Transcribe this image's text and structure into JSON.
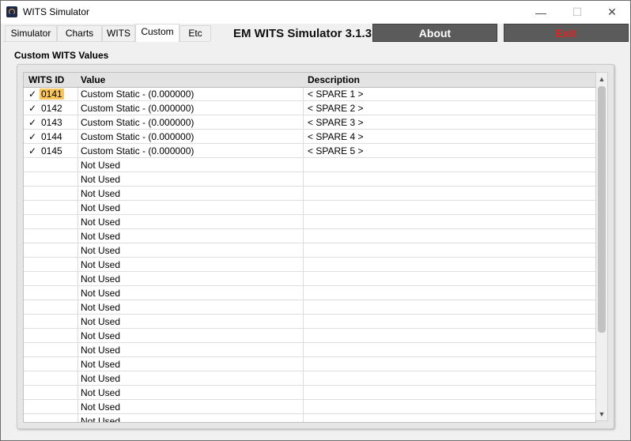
{
  "window": {
    "title": "WITS Simulator",
    "controls": {
      "minimize": "—",
      "maximize": "☐",
      "close": "✕"
    }
  },
  "tabs": [
    {
      "label": "Simulator",
      "active": false
    },
    {
      "label": "Charts",
      "active": false
    },
    {
      "label": "WITS",
      "active": false
    },
    {
      "label": "Custom",
      "active": true
    },
    {
      "label": "Etc",
      "active": false
    }
  ],
  "app_header": "EM WITS Simulator 3.1.3",
  "buttons": {
    "about": "About",
    "exit": "Exit"
  },
  "section_title": "Custom WITS Values",
  "grid": {
    "columns": [
      "WITS ID",
      "Value",
      "Description"
    ],
    "rows": [
      {
        "checked": "✓",
        "id": "0141",
        "value": "Custom Static - (0.000000)",
        "description": "< SPARE 1 >",
        "selected": true
      },
      {
        "checked": "✓",
        "id": "0142",
        "value": "Custom Static - (0.000000)",
        "description": "< SPARE 2 >"
      },
      {
        "checked": "✓",
        "id": "0143",
        "value": "Custom Static - (0.000000)",
        "description": "< SPARE 3 >"
      },
      {
        "checked": "✓",
        "id": "0144",
        "value": "Custom Static - (0.000000)",
        "description": "< SPARE 4 >"
      },
      {
        "checked": "✓",
        "id": "0145",
        "value": "Custom Static - (0.000000)",
        "description": "< SPARE 5 >"
      },
      {
        "checked": "",
        "id": "",
        "value": "Not Used",
        "description": ""
      },
      {
        "checked": "",
        "id": "",
        "value": "Not Used",
        "description": ""
      },
      {
        "checked": "",
        "id": "",
        "value": "Not Used",
        "description": ""
      },
      {
        "checked": "",
        "id": "",
        "value": "Not Used",
        "description": ""
      },
      {
        "checked": "",
        "id": "",
        "value": "Not Used",
        "description": ""
      },
      {
        "checked": "",
        "id": "",
        "value": "Not Used",
        "description": ""
      },
      {
        "checked": "",
        "id": "",
        "value": "Not Used",
        "description": ""
      },
      {
        "checked": "",
        "id": "",
        "value": "Not Used",
        "description": ""
      },
      {
        "checked": "",
        "id": "",
        "value": "Not Used",
        "description": ""
      },
      {
        "checked": "",
        "id": "",
        "value": "Not Used",
        "description": ""
      },
      {
        "checked": "",
        "id": "",
        "value": "Not Used",
        "description": ""
      },
      {
        "checked": "",
        "id": "",
        "value": "Not Used",
        "description": ""
      },
      {
        "checked": "",
        "id": "",
        "value": "Not Used",
        "description": ""
      },
      {
        "checked": "",
        "id": "",
        "value": "Not Used",
        "description": ""
      },
      {
        "checked": "",
        "id": "",
        "value": "Not Used",
        "description": ""
      },
      {
        "checked": "",
        "id": "",
        "value": "Not Used",
        "description": ""
      },
      {
        "checked": "",
        "id": "",
        "value": "Not Used",
        "description": ""
      },
      {
        "checked": "",
        "id": "",
        "value": "Not Used",
        "description": ""
      },
      {
        "checked": "",
        "id": "",
        "value": "Not Used",
        "description": ""
      }
    ]
  },
  "scrollbar": {
    "up": "▲",
    "down": "▼"
  },
  "colors": {
    "button_bg": "#5b5b5b",
    "exit_text": "#e52020",
    "selected_id": "#fbc55d"
  }
}
